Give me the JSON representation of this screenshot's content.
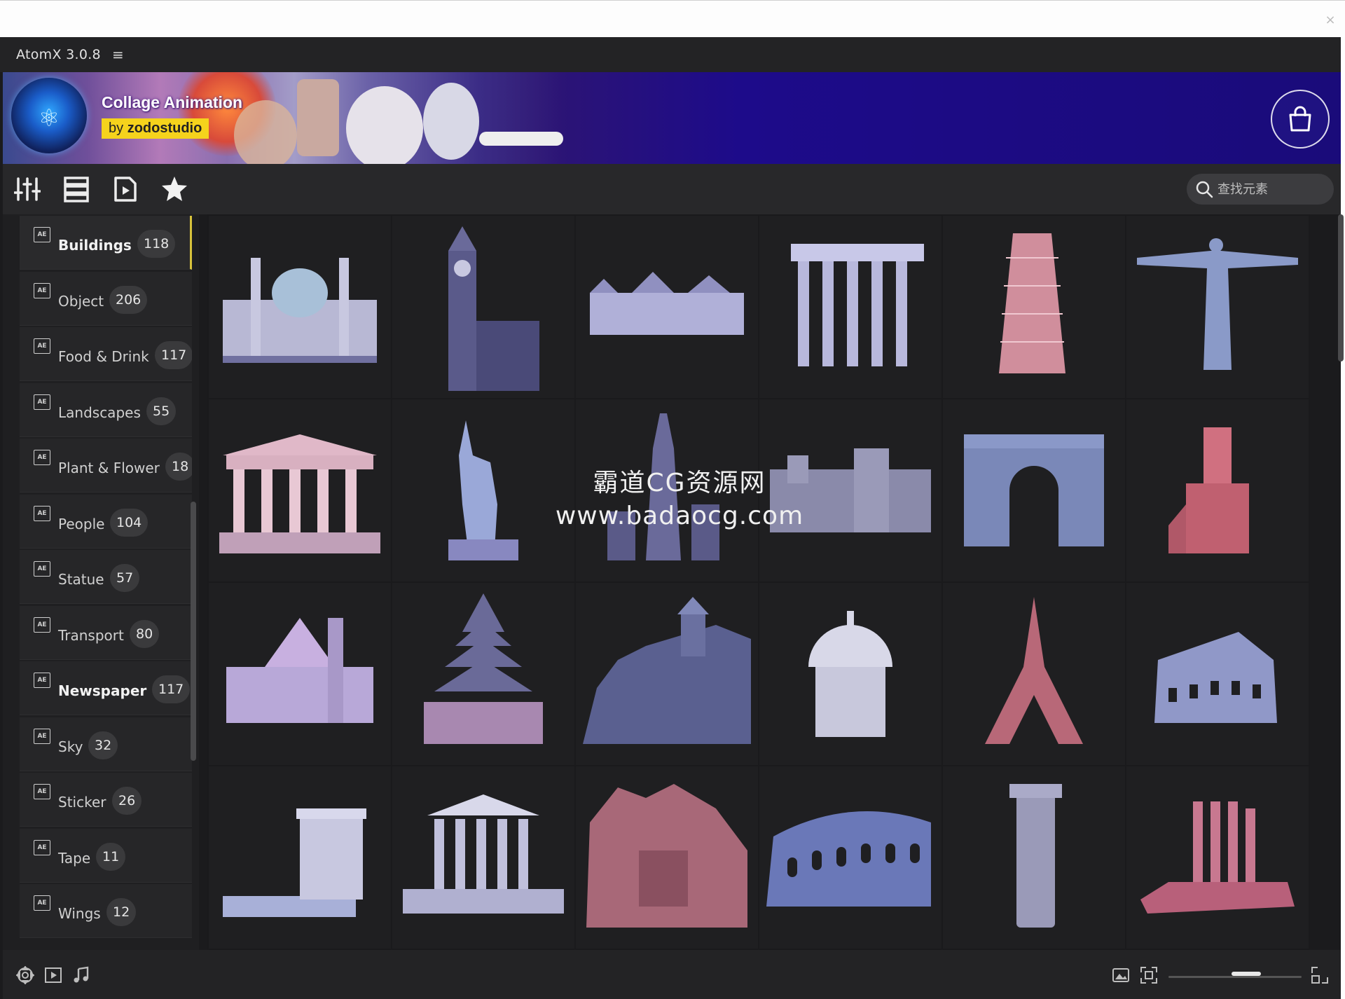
{
  "app": {
    "title": "AtomX 3.0.8"
  },
  "window": {
    "close_glyph": "×"
  },
  "banner": {
    "title": "Collage Animation",
    "by_prefix": "by",
    "by_author": "zodostudio",
    "bag_icon": "shopping-bag-icon"
  },
  "toolbar": {
    "icons": [
      "sliders-icon",
      "list-icon",
      "video-file-icon",
      "star-icon"
    ],
    "search_placeholder": "查找元素"
  },
  "sidebar": {
    "items": [
      {
        "label": "Buildings",
        "count": "118",
        "active": true
      },
      {
        "label": "Object",
        "count": "206"
      },
      {
        "label": "Food & Drink",
        "count": "117"
      },
      {
        "label": "Landscapes",
        "count": "55"
      },
      {
        "label": "Plant & Flower",
        "count": "18"
      },
      {
        "label": "People",
        "count": "104"
      },
      {
        "label": "Statue",
        "count": "57"
      },
      {
        "label": "Transport",
        "count": "80"
      },
      {
        "label": "Newspaper",
        "count": "117",
        "bold": true
      },
      {
        "label": "Sky",
        "count": "32"
      },
      {
        "label": "Sticker",
        "count": "26"
      },
      {
        "label": "Tape",
        "count": "11"
      },
      {
        "label": "Wings",
        "count": "12"
      }
    ]
  },
  "grid": {
    "tiles": [
      "baroque-church",
      "big-ben",
      "chateau",
      "greek-temple-ruin",
      "leaning-tower-of-pisa",
      "christ-the-redeemer",
      "greek-temple",
      "statue-of-liberty",
      "skyscraper-city",
      "stone-castle",
      "arc-de-triomphe",
      "red-church-tower",
      "gothic-cathedral",
      "pagoda",
      "fortress-on-hill",
      "capitol-dome",
      "eiffel-tower",
      "colosseum",
      "erechtheion",
      "supreme-court",
      "petra-treasury",
      "roman-amphitheater",
      "stone-tower",
      "temple-ruins"
    ]
  },
  "watermark": {
    "line1": "霸道CG资源网",
    "line2": "www.badaocg.com"
  },
  "bottombar": {
    "left_icons": [
      "move-icon",
      "play-box-icon",
      "music-note-icon"
    ],
    "right_icons": [
      "photo-icon",
      "fit-frame-icon",
      "expand-icon"
    ],
    "zoom_level": 0.5
  },
  "colors": {
    "accent": "#d8c23b",
    "banner_blue": "#1d0b8a",
    "badge_yellow": "#f5d31c"
  }
}
